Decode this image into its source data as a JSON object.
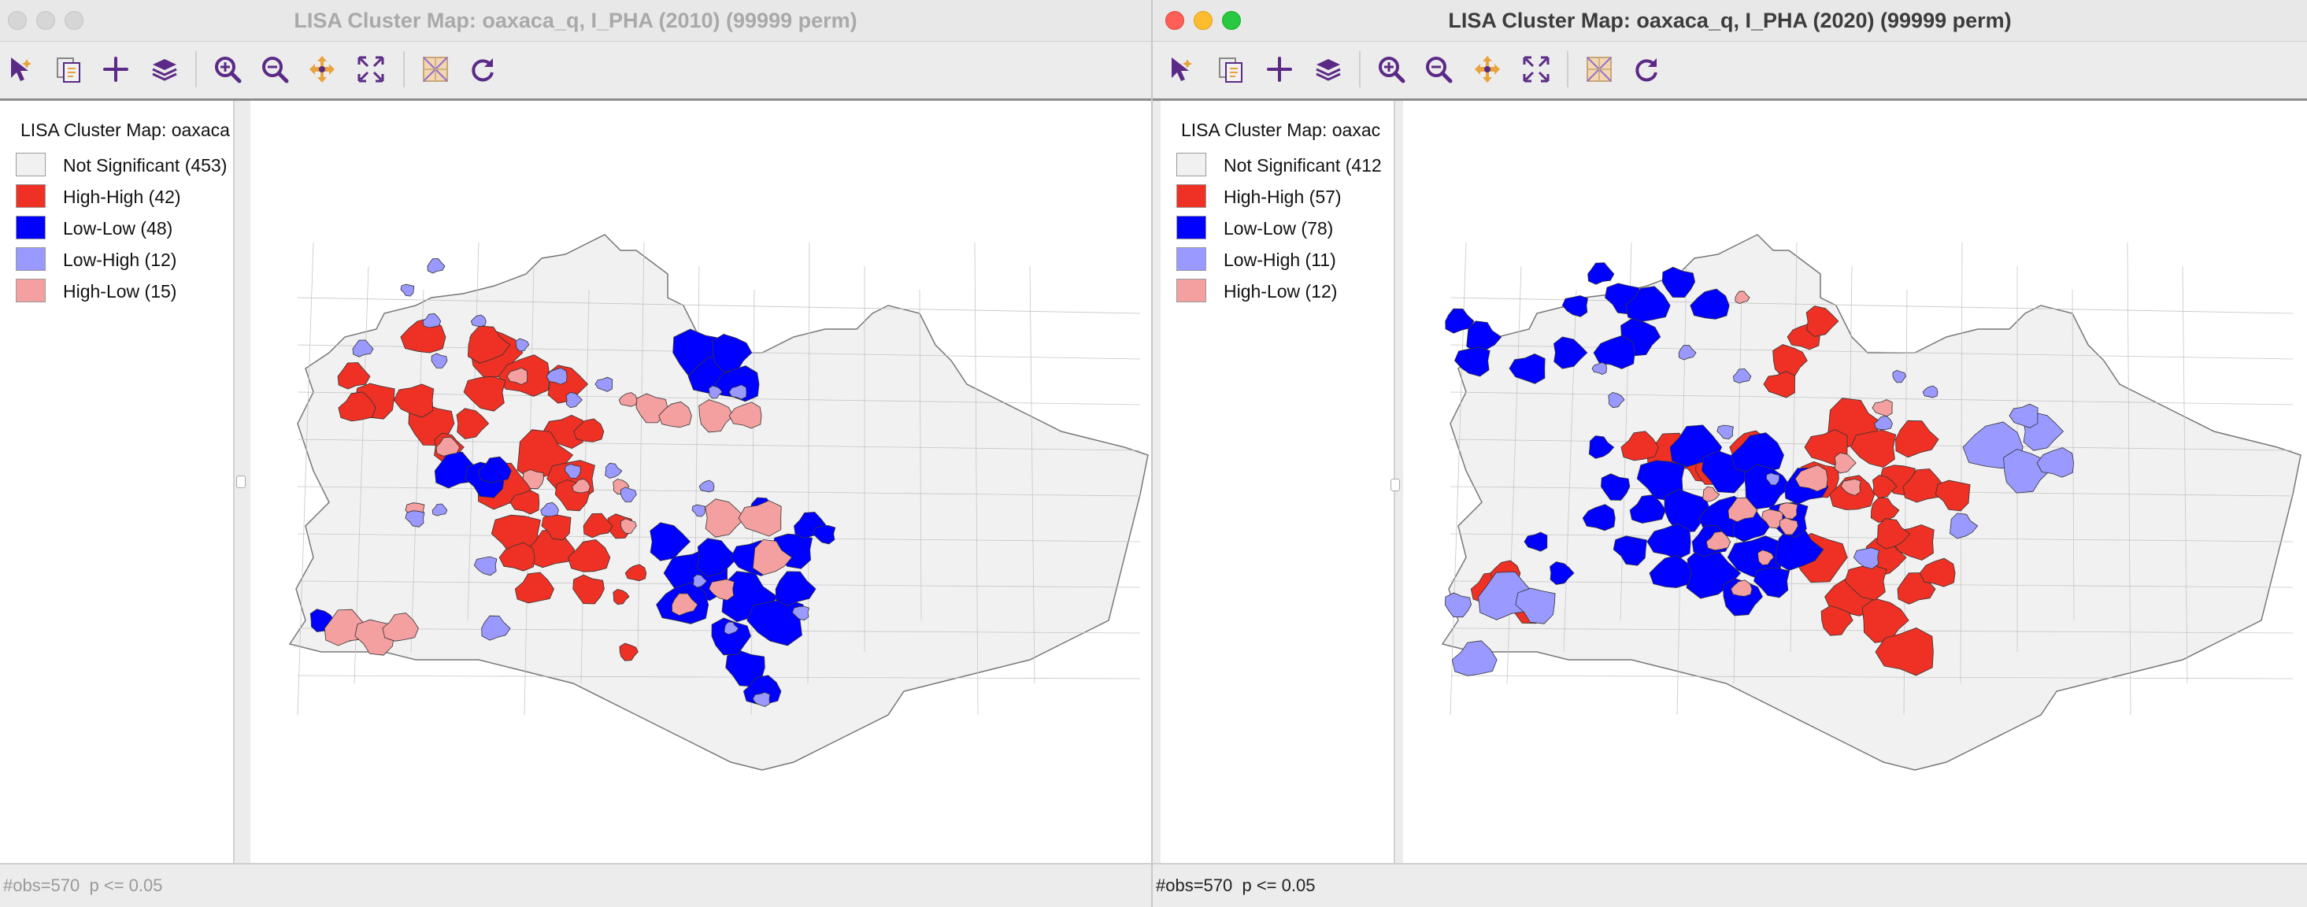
{
  "windows": [
    {
      "id": "left",
      "title": "LISA Cluster Map: oaxaca_q, I_PHA (2010) (99999 perm)",
      "legend_title": "LISA Cluster Map: oaxaca",
      "legend": [
        {
          "label": "Not Significant (453)",
          "color": "#f1f1f1"
        },
        {
          "label": "High-High (42)",
          "color": "#ee3124"
        },
        {
          "label": "Low-Low (48)",
          "color": "#0000ff"
        },
        {
          "label": "Low-High (12)",
          "color": "#9999ff"
        },
        {
          "label": "High-Low (15)",
          "color": "#f4a0a0"
        }
      ],
      "status": "#obs=570  p <= 0.05"
    },
    {
      "id": "right",
      "title": "LISA Cluster Map: oaxaca_q, I_PHA (2020) (99999 perm)",
      "legend_title": "LISA Cluster Map: oaxac",
      "legend": [
        {
          "label": "Not Significant (412",
          "color": "#f1f1f1"
        },
        {
          "label": "High-High (57)",
          "color": "#ee3124"
        },
        {
          "label": "Low-Low (78)",
          "color": "#0000ff"
        },
        {
          "label": "Low-High (11)",
          "color": "#9999ff"
        },
        {
          "label": "High-Low (12)",
          "color": "#f4a0a0"
        }
      ],
      "status": "#obs=570  p <= 0.05"
    }
  ],
  "toolbar_icons": [
    "select-icon",
    "copy-selection-icon",
    "add-icon",
    "layers-icon",
    "zoom-in-icon",
    "zoom-out-icon",
    "pan-icon",
    "fit-extent-icon",
    "basemap-icon",
    "refresh-icon"
  ],
  "colors": {
    "not_significant": "#f1f1f1",
    "high_high": "#ee3124",
    "low_low": "#0000ff",
    "low_high": "#9999ff",
    "high_low": "#f4a0a0",
    "toolbar_icon": "#5b2a86",
    "toolbar_accent": "#e8a33d"
  }
}
